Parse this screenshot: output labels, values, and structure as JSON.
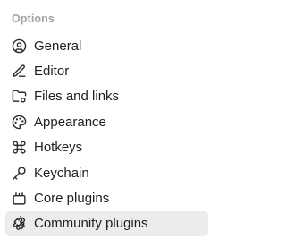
{
  "settings_nav": {
    "heading": "Options",
    "active_index": 7,
    "items": [
      {
        "label": "General",
        "icon": "user-circle-icon"
      },
      {
        "label": "Editor",
        "icon": "pencil-icon"
      },
      {
        "label": "Files and links",
        "icon": "folder-link-icon"
      },
      {
        "label": "Appearance",
        "icon": "palette-icon"
      },
      {
        "label": "Hotkeys",
        "icon": "command-icon"
      },
      {
        "label": "Keychain",
        "icon": "key-icon"
      },
      {
        "label": "Core plugins",
        "icon": "core-plugins-icon"
      },
      {
        "label": "Community plugins",
        "icon": "puzzle-icon"
      }
    ]
  },
  "colors": {
    "heading": "#a3a3a3",
    "text": "#202020",
    "active_background": "#ececec",
    "background": "#ffffff"
  }
}
